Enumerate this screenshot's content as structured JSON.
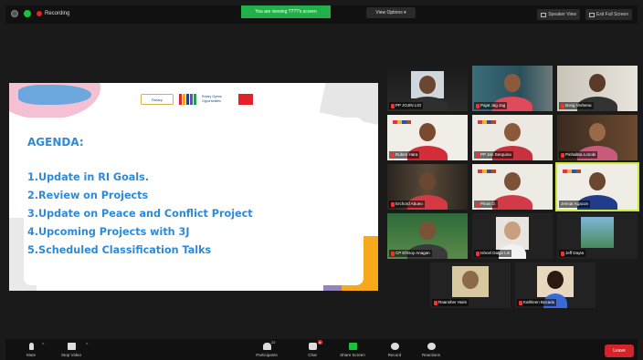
{
  "topbar": {
    "recording_label": "Recording",
    "share_banner": "You are viewing ????'s screen",
    "view_options": "View Options",
    "speaker_view": "Speaker View",
    "exit_full_screen": "Exit Full Screen"
  },
  "slide": {
    "logos": {
      "rotary": "Rotary",
      "opportunities": "Rotary Opens Opportunities"
    },
    "agenda_title": "AGENDA:",
    "items": [
      "1.Update in RI Goals.",
      "2.Review on Projects",
      "3.Update on Peace and Conflict Project",
      "4.Upcoming Projects with 3J",
      "5.Scheduled Classification Talks"
    ]
  },
  "participants": [
    {
      "name": "PP JOJIN LIO"
    },
    {
      "name": "Pajat Jag Jag"
    },
    {
      "name": "Bong Verbena"
    },
    {
      "name": "Ruben Hara"
    },
    {
      "name": "PP Jan Serquina"
    },
    {
      "name": "Pinhallna Lonobi"
    },
    {
      "name": "Erchord Abueo"
    },
    {
      "name": "Pinas D."
    },
    {
      "name": "Jennar Agacon"
    },
    {
      "name": "CP Efrisoy Anagan"
    },
    {
      "name": "Ishnel Dalgo Lin"
    },
    {
      "name": "Jeff Dayta"
    },
    {
      "name": "Raansher Haim"
    },
    {
      "name": "Kathleen Bocadu"
    }
  ],
  "toolbar": {
    "mute": "Mute",
    "stop_video": "Stop Video",
    "participants": "Participants",
    "participants_count": "22",
    "chat": "Chat",
    "share_screen": "Share Screen",
    "record": "Record",
    "reactions": "Reactions",
    "leave": "Leave"
  },
  "colors": {
    "agenda_text": "#2e8ad8",
    "share_green": "#22b04a",
    "leave_red": "#d3242b",
    "active_speaker_outline": "#c8e83a"
  }
}
